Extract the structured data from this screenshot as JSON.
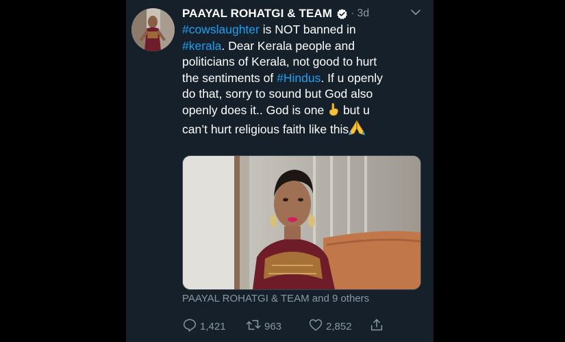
{
  "tweet": {
    "author_name": "PAAYAL ROHATGI & TEAM",
    "dot": "·",
    "timestamp": "3d",
    "lines": [
      [
        {
          "t": "#cowslaughter",
          "h": true
        },
        {
          "t": " is NOT banned in",
          "h": false
        }
      ],
      [
        {
          "t": "#kerala",
          "h": true
        },
        {
          "t": ". Dear Kerala people and",
          "h": false
        }
      ],
      [
        {
          "t": "politicians of Kerala, not good to hurt",
          "h": false
        }
      ],
      [
        {
          "t": "the sentiments of ",
          "h": false
        },
        {
          "t": "#Hindus",
          "h": true
        },
        {
          "t": ". If u openly",
          "h": false
        }
      ],
      [
        {
          "t": "do that, sorry to sound but God also",
          "h": false
        }
      ],
      [
        {
          "t": "openly does it.. God is one ",
          "h": false
        },
        {
          "e": "point-up"
        },
        {
          "t": " but u",
          "h": false
        }
      ],
      [
        {
          "t": "can’t hurt religious faith like this",
          "h": false
        },
        {
          "e": "pray"
        }
      ]
    ],
    "tagged_people": "PAAYAL ROHATGI & TEAM and 9 others",
    "actions": {
      "reply_count": "1,421",
      "retweet_count": "963",
      "like_count": "2,852"
    }
  },
  "icons": {
    "verified": "verified-badge-icon",
    "caret": "chevron-down-icon",
    "reply": "reply-icon",
    "retweet": "retweet-icon",
    "like": "heart-icon",
    "share": "share-icon"
  },
  "colors": {
    "background": "#15202b",
    "text": "#ffffff",
    "secondary": "#8899a6",
    "link": "#1da1f2"
  }
}
